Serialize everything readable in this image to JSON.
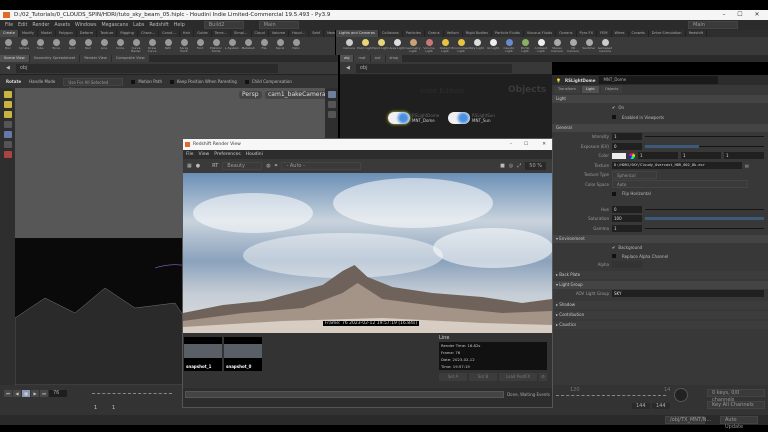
{
  "title": "D:/02_Tutorials/0_CLOUDS_SPIN/HDRI/tuto_sky_beam_05.hiplc - Houdini Indie Limited-Commercial 19.5.493 - Py3.9",
  "menu": [
    "File",
    "Edit",
    "Render",
    "Assets",
    "Windows",
    "Megascans",
    "Labs",
    "Redshift",
    "Help"
  ],
  "desktop": "Build2",
  "desktop2": "Main",
  "desktop_right": "Main",
  "shelf_tabs_left": [
    "Create",
    "Modify",
    "Model",
    "Polygon",
    "Deform",
    "Texture",
    "Rigging",
    "Chara...",
    "Const...",
    "Hair",
    "Guide",
    "Terra...",
    "Simpl...",
    "Cloud",
    "Volume",
    "Houd...",
    "Sebf",
    "New S..."
  ],
  "shelf_tabs_right": [
    "Lights and Cameras",
    "Collisions",
    "Particles",
    "Grains",
    "Vellum",
    "Rigid Bodies",
    "Particle Fluids",
    "Viscous Fluids",
    "Oceans",
    "Pyro FX",
    "FEM",
    "Wires",
    "Crowds",
    "Drive Simulation",
    "Redshift"
  ],
  "shelf_tools_left": [
    "Box",
    "Sphere",
    "Tube",
    "Torus",
    "Grid",
    "Null",
    "Line",
    "Circle",
    "Curve Bezier",
    "Draw Curve",
    "Path",
    "Spray Paint",
    "Font",
    "Platonic Solids",
    "L-System",
    "Metaball",
    "File",
    "Spiral",
    "Helix"
  ],
  "shelf_tools_right": [
    "Camera",
    "Point Light",
    "Spot Light",
    "Area Light",
    "Geometry Light",
    "Volume Light",
    "Distant Light",
    "Environment Light",
    "Sky Light",
    "GI Light",
    "Caustic Light",
    "Portal Light",
    "Ambient Light",
    "Stereo Camera",
    "VR Camera",
    "Switcher",
    "Gamepad Camera"
  ],
  "pane_tabs_left": [
    "Scene View",
    "Geometry Spreadsheet",
    "Render View",
    "Composite View"
  ],
  "pane_tabs_right": [
    "obj",
    "mat",
    "out",
    "shop"
  ],
  "path": "obj",
  "opbar": {
    "tool": "Rotate",
    "handle_mode": "Handle Mode",
    "use_all": "Use For All Selected Objects",
    "motion_path": "Motion Path",
    "keep_pos": "Keep Position When Parenting",
    "child_comp": "Child Compensation"
  },
  "viewport": {
    "persp": "Persp",
    "camera": "cam1_bakeCamera"
  },
  "node_editor": {
    "watermark1": "Indie Edition",
    "watermark2": "Objects",
    "nodes": [
      {
        "type": "RSLightDome",
        "name": "MNT_Dome"
      },
      {
        "type": "RSLightSun",
        "name": "MNT_Sun"
      }
    ]
  },
  "params": {
    "type": "RSLightDome",
    "name": "MNT_Dome",
    "tabs": [
      "Transform",
      "Light",
      "Objects"
    ],
    "light_section": "Light",
    "on": "On",
    "enabled_vp": "Enabled in Viewports",
    "general": "General",
    "intensity": {
      "label": "Intensity",
      "value": "1"
    },
    "exposure": {
      "label": "Exposure (EV)",
      "value": "0"
    },
    "color": {
      "label": "Color",
      "r": "1",
      "g": "1",
      "b": "1"
    },
    "texture": {
      "label": "Texture",
      "value": "D:/HDRI/SKY/Cloudy_Overcast_HDR_002_8k.exr"
    },
    "texture_type": {
      "label": "Texture Type",
      "value": "Spherical"
    },
    "color_space": {
      "label": "Color Space",
      "value": "Auto"
    },
    "flip": "Flip Horizontal",
    "hue": {
      "label": "Hue",
      "value": "0"
    },
    "saturation": {
      "label": "Saturation",
      "value": "100"
    },
    "gamma": {
      "label": "Gamma",
      "value": "1"
    },
    "environment": "Environment",
    "background": "Background",
    "replace_alpha": "Replace Alpha Channel",
    "alpha": "Alpha",
    "back_plate": "Back Plate",
    "light_group": "Light Group",
    "aov": {
      "label": "AOV Light Group",
      "value": "SKY"
    },
    "shadow": "Shadow",
    "contribution": "Contribution",
    "caustics": "Caustics"
  },
  "render_view": {
    "title": "Redshift Render View",
    "menu": [
      "File",
      "View",
      "Preferences",
      "Houdini"
    ],
    "aov": "Beauty",
    "camera": "- Auto -",
    "zoom": "50 %",
    "frame_info": "Frame: 76  2023-02-12  19:57:19  (16.84s)",
    "snapshots": [
      "snapshot_1",
      "snapshot_0"
    ],
    "line_label": "Line",
    "line_info": [
      "Render Time: 16.82s",
      "Frame: 76",
      "Date: 2023-02-12",
      "Time: 19:57:19"
    ],
    "set_a": "Set A",
    "set_b": "Set B",
    "load_postfx": "Load PostFX",
    "status": "Done, Waiting Events"
  },
  "timeline": {
    "frame": "76",
    "start": "1",
    "start2": "1",
    "end": "144",
    "end2": "144",
    "tick": "120",
    "tick2": "14",
    "keys": "0 keys, 0/0 channels",
    "key_all": "Key All Channels"
  },
  "status": {
    "path": "/obj/TX_MNT/N...",
    "auto_update": "Auto Update"
  }
}
